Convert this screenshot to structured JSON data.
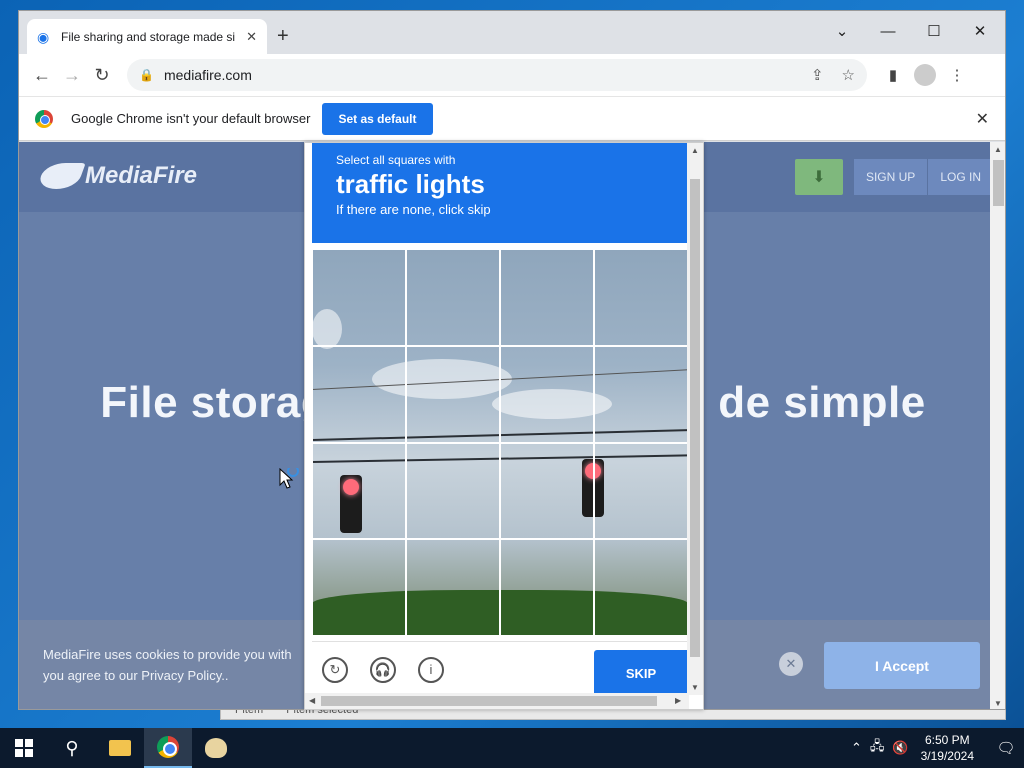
{
  "browser": {
    "tab_title": "File sharing and storage made si",
    "new_tab": "+",
    "url": "mediafire.com",
    "window_controls": [
      "⌄",
      "—",
      "☐",
      "✕"
    ]
  },
  "infobar": {
    "message": "Google Chrome isn't your default browser",
    "button": "Set as default",
    "close": "✕"
  },
  "site": {
    "logo": "MediaFire",
    "signup": "SIGN UP",
    "login": "LOG IN",
    "hero_left": "File storag",
    "hero_right": "de simple"
  },
  "cookie": {
    "line1": "MediaFire uses cookies to provide you with",
    "line2": "you agree to our Privacy Policy..",
    "accept": "I Accept",
    "close": "✕"
  },
  "captcha": {
    "instruction": "Select all squares with",
    "target": "traffic lights",
    "hint": "If there are none, click skip",
    "skip": "SKIP",
    "grid_rows": 4,
    "grid_cols": 4
  },
  "ghost": {
    "item1": "Pitem",
    "item2": "Pitem selected"
  },
  "taskbar": {
    "time": "6:50 PM",
    "date": "3/19/2024"
  },
  "colors": {
    "accent": "#1a73e8",
    "page_overlay": "#677fa9",
    "taskbar": "#0c1a2d"
  }
}
